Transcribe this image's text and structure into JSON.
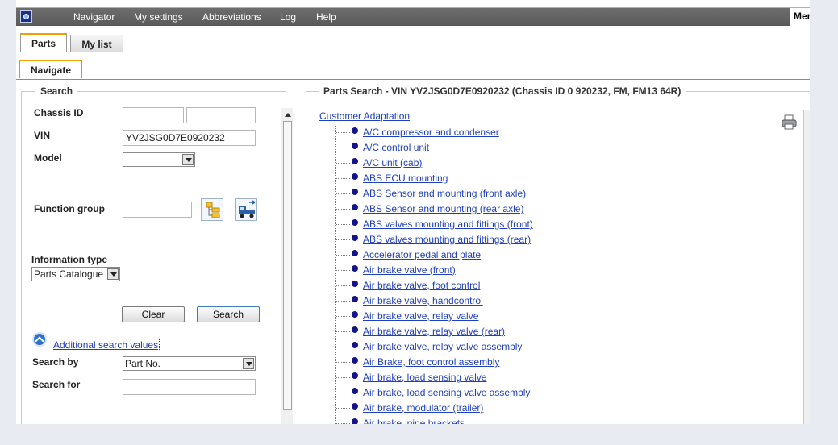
{
  "menu": {
    "items": [
      "Navigator",
      "My settings",
      "Abbreviations",
      "Log",
      "Help"
    ],
    "right_label": "Mer"
  },
  "tabs": {
    "main": [
      "Parts",
      "My list"
    ],
    "sub": "Navigate"
  },
  "search_panel": {
    "legend": "Search",
    "chassis_label": "Chassis ID",
    "chassis_value_1": "",
    "chassis_value_2": "",
    "vin_label": "VIN",
    "vin_value": "YV2JSG0D7E0920232",
    "model_label": "Model",
    "model_value": "",
    "function_group_label": "Function group",
    "function_group_value": "",
    "info_type_label": "Information type",
    "info_type_value": "Parts Catalogue",
    "clear_label": "Clear",
    "search_label": "Search",
    "additional_label": "Additional search values",
    "search_by_label": "Search by",
    "search_by_value": "Part No.",
    "search_for_label": "Search for",
    "search_for_value": ""
  },
  "results": {
    "legend": "Parts Search - VIN YV2JSG0D7E0920232 (Chassis ID 0 920232, FM, FM13 64R)",
    "root": "Customer Adaptation",
    "items": [
      "A/C compressor and condenser",
      "A/C control unit",
      "A/C unit (cab)",
      "ABS ECU mounting",
      "ABS Sensor and mounting (front axle)",
      "ABS Sensor and mounting (rear axle)",
      "ABS valves mounting and fittings (front)",
      "ABS valves mounting and fittings (rear)",
      "Accelerator pedal and plate",
      "Air brake valve (front)",
      "Air brake valve, foot control",
      "Air brake valve, handcontrol",
      "Air brake valve, relay valve",
      "Air brake valve, relay valve (rear)",
      "Air brake valve, relay valve assembly",
      "Air Brake, foot control assembly",
      "Air brake, load sensing valve",
      "Air brake, load sensing valve assembly",
      "Air brake, modulator (trailer)",
      "Air brake, pipe brackets"
    ]
  },
  "colors": {
    "menubar": "#5f5f5f",
    "tab_accent": "#f0a000",
    "link": "#1f3fbf",
    "bullet": "#14148a"
  }
}
